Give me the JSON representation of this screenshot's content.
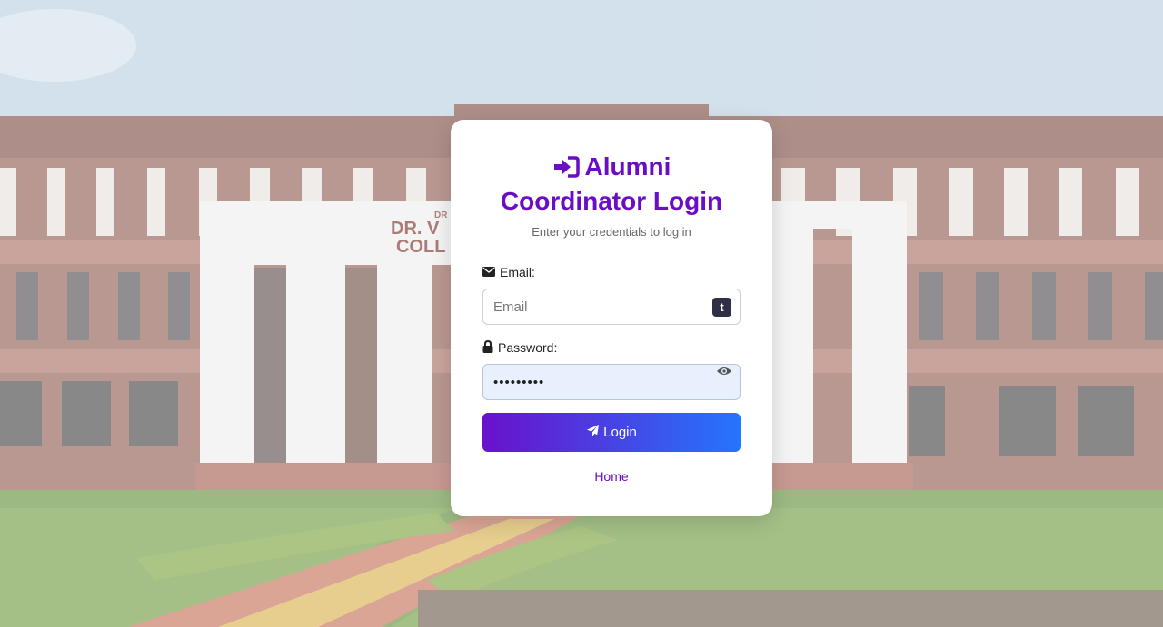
{
  "background": {
    "sign_line1": "DR",
    "sign_line2": "DR. V",
    "sign_line3": "COLL"
  },
  "login": {
    "title": "Alumni Coordinator Login",
    "title_icon": "sign-in-icon",
    "subtitle": "Enter your credentials to log in",
    "email_label": "Email:",
    "email_icon": "envelope-icon",
    "email_placeholder": "Email",
    "email_value": "",
    "extension_badge": "t",
    "password_label": "Password:",
    "password_icon": "lock-icon",
    "password_value": "•••••••••",
    "password_toggle_icon": "eye-icon",
    "login_button": "Login",
    "login_icon": "paper-plane-icon",
    "home_link": "Home"
  },
  "colors": {
    "accent": "#6a0dc4",
    "gradient_start": "#6a11cb",
    "gradient_end": "#2575fc",
    "autofill_bg": "#e8f0fe"
  }
}
